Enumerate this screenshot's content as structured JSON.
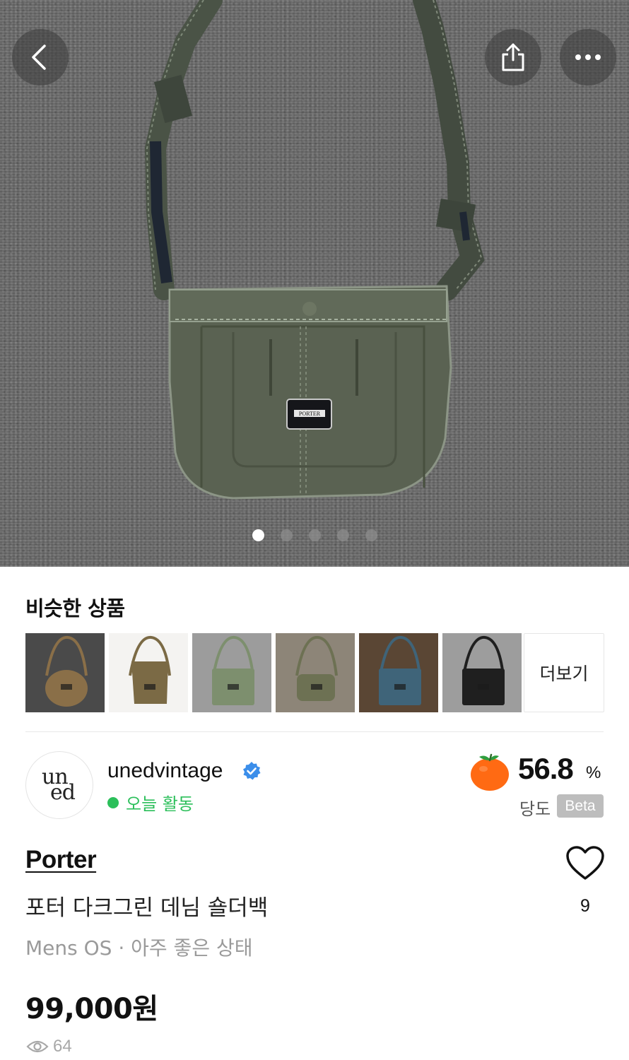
{
  "hero": {
    "image_count": 5,
    "active_index": 0
  },
  "nav": {
    "back_icon": "chevron-left-icon",
    "share_icon": "share-icon",
    "more_icon": "more-horizontal-icon"
  },
  "similar": {
    "title": "비슷한 상품",
    "more_label": "더보기",
    "items": [
      {
        "bag_color": "#8a6f48",
        "bg_color": "#4a4a4a",
        "shape": "round"
      },
      {
        "bag_color": "#7b6a45",
        "bg_color": "#f4f3f1",
        "shape": "flat"
      },
      {
        "bag_color": "#7d8f6e",
        "bg_color": "#9c9c9c",
        "shape": "square"
      },
      {
        "bag_color": "#6d7153",
        "bg_color": "#8d8578",
        "shape": "pouch"
      },
      {
        "bag_color": "#3f6479",
        "bg_color": "#5a4634",
        "shape": "square"
      },
      {
        "bag_color": "#1f1f1f",
        "bg_color": "#9d9d9d",
        "shape": "square"
      }
    ]
  },
  "seller": {
    "avatar_line1": "un",
    "avatar_line2": "ed",
    "name": "unedvintage",
    "status": "오늘 활동",
    "sweetness_value": "56.8",
    "sweetness_unit": "%",
    "sweetness_label": "당도",
    "beta_label": "Beta"
  },
  "product": {
    "brand": "Porter",
    "title": "포터 다크그린 데님 숄더백",
    "meta": "Mens OS · 아주 좋은 상태",
    "price": "99,000원",
    "likes": "9",
    "views": "64"
  },
  "colors": {
    "accent_green": "#2bbf5a",
    "verified_blue": "#3b8eea",
    "sweetness_orange": "#ff6a13"
  }
}
